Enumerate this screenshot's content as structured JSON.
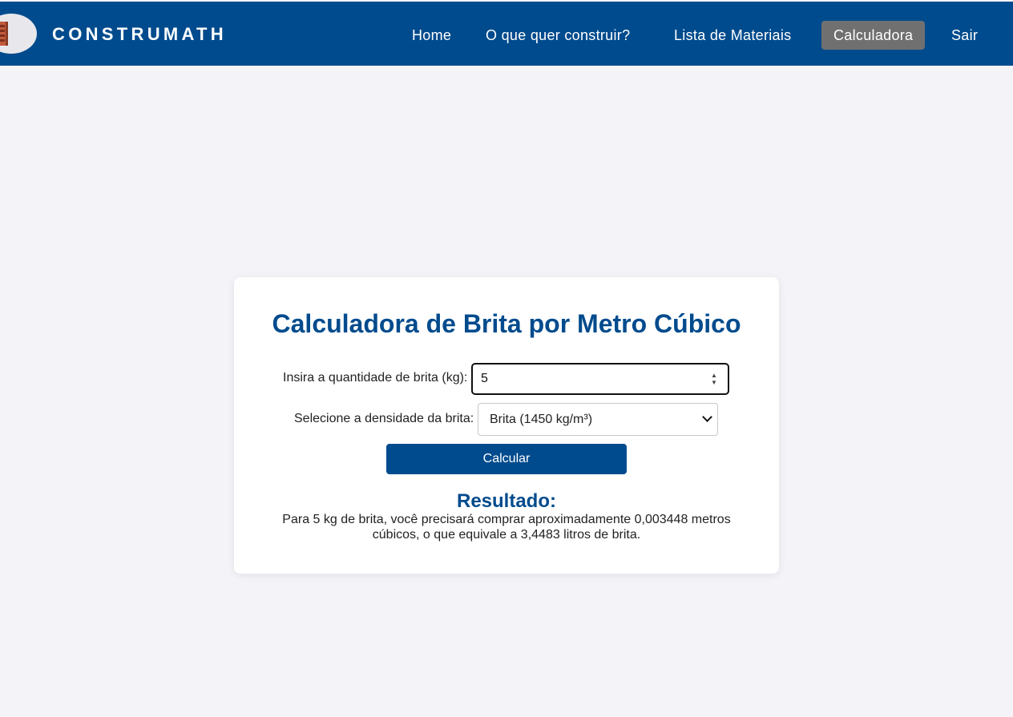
{
  "header": {
    "brand": "CONSTRUMATH",
    "logo_icon": "brick-logo-icon",
    "nav": [
      {
        "label": "Home",
        "active": false
      },
      {
        "label": "O que quer construir?",
        "active": false
      },
      {
        "label": "Lista de Materiais",
        "active": false
      },
      {
        "label": "Calculadora",
        "active": true
      },
      {
        "label": "Sair",
        "active": false
      }
    ],
    "colors": {
      "bar": "#004b8d",
      "active_bg": "#707070"
    }
  },
  "calculator": {
    "title": "Calculadora de Brita por Metro Cúbico",
    "quantity_label": "Insira a quantidade de brita (kg):",
    "quantity_value": "5",
    "density_label": "Selecione a densidade da brita:",
    "density_selected": "Brita (1450 kg/m³)",
    "calculate_label": "Calcular",
    "result_title": "Resultado:",
    "result_text": "Para 5 kg de brita, você precisará comprar aproximadamente 0,003448 metros cúbicos, o que equivale a 3,4483 litros de brita."
  },
  "colors": {
    "page_bg": "#f4f4f8",
    "accent": "#004b8d"
  }
}
